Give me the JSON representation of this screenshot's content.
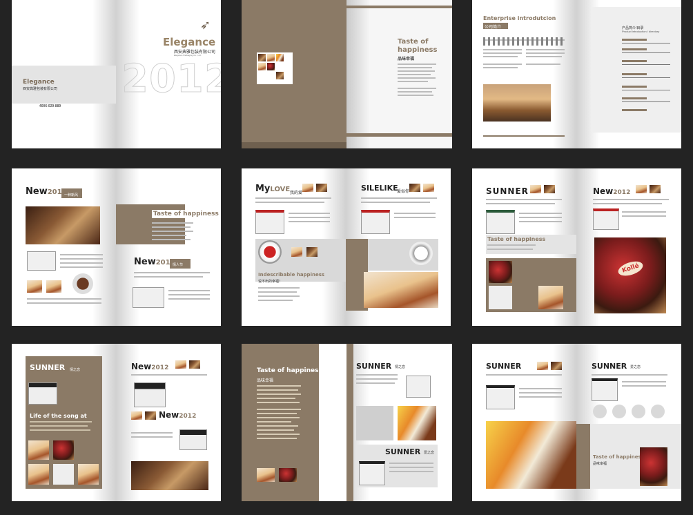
{
  "spread1": {
    "brand": "Elegance",
    "company_cn": "西安典雅包装有限公司",
    "company_en": "Elegance Packaging Co., Ltd.",
    "small_brand": "Elegance",
    "small_company_cn": "西安典雅包装有限公司",
    "phone": "4006-029-889",
    "year": "2012"
  },
  "spread2": {
    "title": "Taste of happiness",
    "subtitle_cn": "品味幸福"
  },
  "spread3": {
    "title": "Enterprise introdutcion",
    "section_cn": "公司简介",
    "toc_title_cn": "产品简介/目录",
    "toc_title_en": "Product introduction / directory"
  },
  "spread4": {
    "heading1": "New",
    "heading1_year": "2012",
    "heading1_cn": "一种新风",
    "taste": "Taste of happiness",
    "heading2": "New",
    "heading2_year": "2012",
    "heading2_cn": "情人节"
  },
  "spread5": {
    "left_title": "My",
    "left_title2": "LOVE",
    "left_cn": "我的爱",
    "right_title": "SILELIKE",
    "right_cn": "爱似你",
    "indescribable": "Indescribable happiness",
    "indescribable_cn": "说不出的幸福！"
  },
  "spread6": {
    "title": "SUNNER",
    "title_right": "New",
    "title_right_year": "2012",
    "taste": "Taste of happiness",
    "badge": "Kollé"
  },
  "spread7": {
    "left_title": "SUNNER",
    "left_cn": "情之恋",
    "song": "Life of the song at",
    "right_new": "New",
    "right_year": "2012",
    "right_new2": "New",
    "right_year2": "2012"
  },
  "spread8": {
    "title": "Taste of happiness",
    "cn": "品味幸福",
    "right_title": "SUNNER",
    "right_cn": "情之恋",
    "right_title2": "SUNNER",
    "right_cn2": "爱之恋"
  },
  "spread9": {
    "left_title": "SUNNER",
    "right_title": "SUNNER",
    "right_cn": "爱之恋",
    "taste": "Taste of happiness",
    "taste_cn": "品味幸福"
  },
  "colors": {
    "taupe": "#8b7a66",
    "background": "#232323",
    "accent_brown": "#7a6a57"
  }
}
